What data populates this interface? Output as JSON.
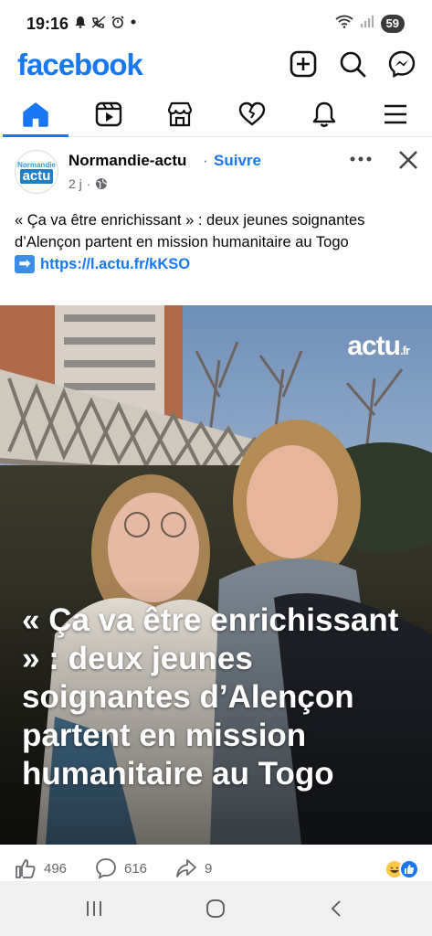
{
  "status_bar": {
    "time": "19:16",
    "battery": "59"
  },
  "header": {
    "logo": "facebook",
    "brand_color": "#1877f2"
  },
  "tabs": [
    {
      "name": "home",
      "icon": "home-icon",
      "active": true
    },
    {
      "name": "video",
      "icon": "video-icon",
      "active": false
    },
    {
      "name": "marketplace",
      "icon": "marketplace-icon",
      "active": false
    },
    {
      "name": "dating",
      "icon": "heart-icon",
      "active": false
    },
    {
      "name": "notifications",
      "icon": "bell-icon",
      "active": false
    },
    {
      "name": "menu",
      "icon": "menu-icon",
      "active": false
    }
  ],
  "post": {
    "avatar_top": "Normandie",
    "avatar_bottom": "actu",
    "page_name": "Normandie-actu",
    "separator": "·",
    "follow_label": "Suivre",
    "time_ago": "2 j",
    "meta_separator": "·",
    "text": "« Ça va être enrichissant » : deux jeunes soignantes d’Alençon partent en mission humanitaire au Togo",
    "link": "https://l.actu.fr/kKSO",
    "image_watermark": "actu",
    "image_watermark_suffix": ".fr",
    "image_headline": "« Ça va être enrichissant » : deux jeunes soignantes d’Alençon partent en mission humanitaire au Togo"
  },
  "reactions": {
    "likes": "496",
    "comments": "616",
    "shares": "9"
  }
}
